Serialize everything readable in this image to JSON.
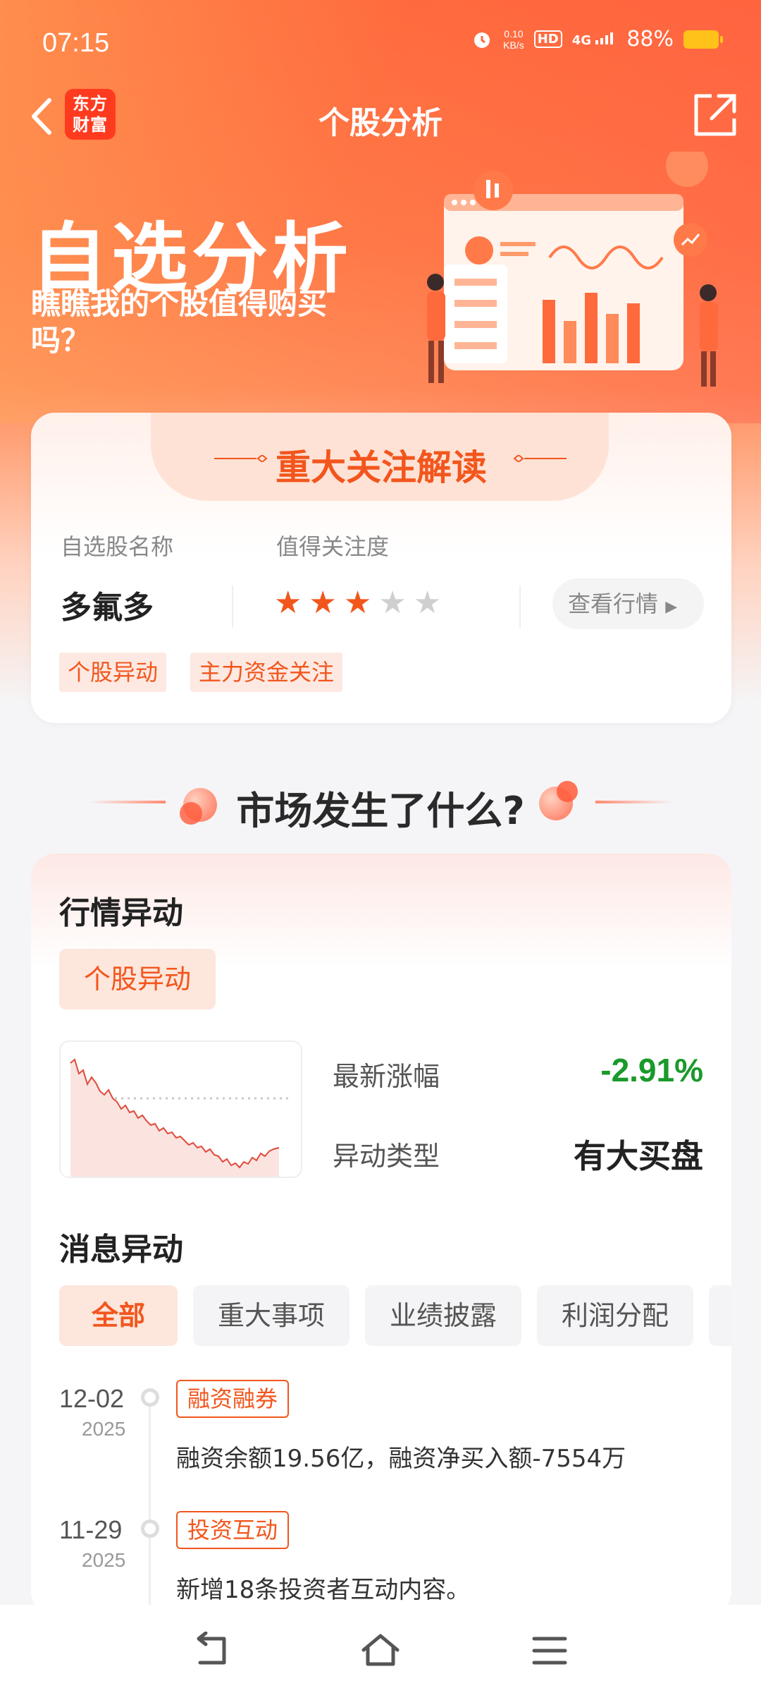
{
  "status_bar": {
    "time": "07:15",
    "speed_value": "0.10",
    "speed_unit": "KB/s",
    "hd": "HD",
    "network": "4G",
    "battery": "88%",
    "battery_color": "#ffc21a"
  },
  "nav": {
    "title": "个股分析",
    "logo_line1": "东方",
    "logo_line2": "财富",
    "back_icon": "back-arrow-icon",
    "share_icon": "share-icon"
  },
  "banner": {
    "title": "自选分析",
    "subtitle": "瞧瞧我的个股值得购买吗？"
  },
  "focus_card": {
    "title": "重大关注解读",
    "stock_name_label": "自选股名称",
    "attention_label": "值得关注度",
    "stock_name": "多氟多",
    "rating": 3,
    "rating_max": 5,
    "view_button": "查看行情",
    "tags": [
      "个股异动",
      "主力资金关注"
    ]
  },
  "section": {
    "title": "市场发生了什么?"
  },
  "market_card": {
    "heading": "行情异动",
    "badge": "个股异动",
    "latest_change_label": "最新涨幅",
    "latest_change_value": "-2.91%",
    "change_color": "#1a9a2a",
    "anomaly_type_label": "异动类型",
    "anomaly_type_value": "有大买盘",
    "news_heading": "消息异动",
    "filters": [
      "全部",
      "重大事项",
      "业绩披露",
      "利润分配"
    ],
    "active_filter": "全部",
    "timeline": [
      {
        "date": "12-02",
        "year": "2025",
        "tag": "融资融券",
        "text": "融资余额19.56亿，融资净买入额-7554万"
      },
      {
        "date": "11-29",
        "year": "2025",
        "tag": "投资互动",
        "text": "新增18条投资者互动内容。"
      }
    ]
  },
  "accent_color": "#f2561d",
  "bottom_nav": {
    "icons": [
      "back-icon",
      "home-icon",
      "menu-icon"
    ]
  }
}
